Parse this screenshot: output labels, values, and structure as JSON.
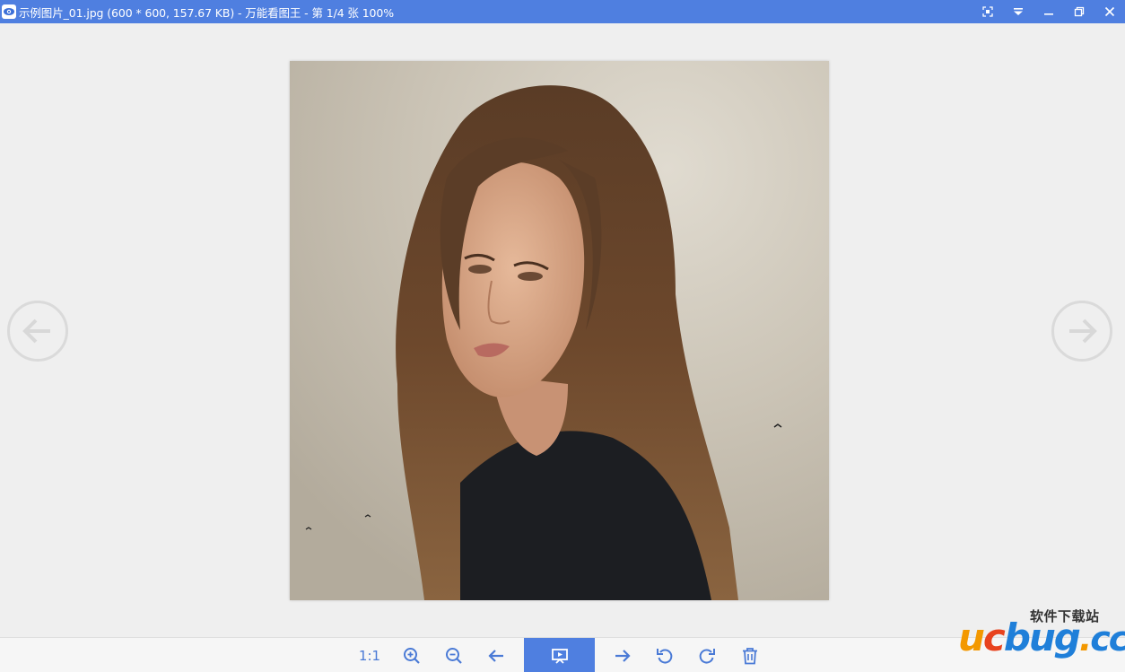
{
  "window": {
    "title": "示例图片_01.jpg (600 * 600, 157.67 KB) - 万能看图王 - 第 1/4 张 100%",
    "controls": [
      "fullscreen-icon",
      "menu-dropdown-icon",
      "minimize-icon",
      "restore-icon",
      "close-icon"
    ]
  },
  "colors": {
    "titlebar": "#4f7fe0",
    "background": "#efefef",
    "toolbar_icon": "#4a7ad6",
    "active_button": "#4f7fe0"
  },
  "viewer": {
    "image_alt": "woman-portrait-photo",
    "prev_arrow": "arrow-left-circle-icon",
    "next_arrow": "arrow-right-circle-icon"
  },
  "toolbar": {
    "actual_size_label": "1:1",
    "buttons": [
      "actual-size",
      "zoom-in-icon",
      "zoom-out-icon",
      "previous-icon",
      "slideshow-icon",
      "next-icon",
      "rotate-left-icon",
      "rotate-right-icon",
      "delete-icon"
    ]
  },
  "watermark": {
    "cn_text": "软件下载站",
    "logo_u": "u",
    "logo_c": "c",
    "logo_bug": "bug",
    "logo_dot": ".",
    "logo_cc": "cc"
  }
}
